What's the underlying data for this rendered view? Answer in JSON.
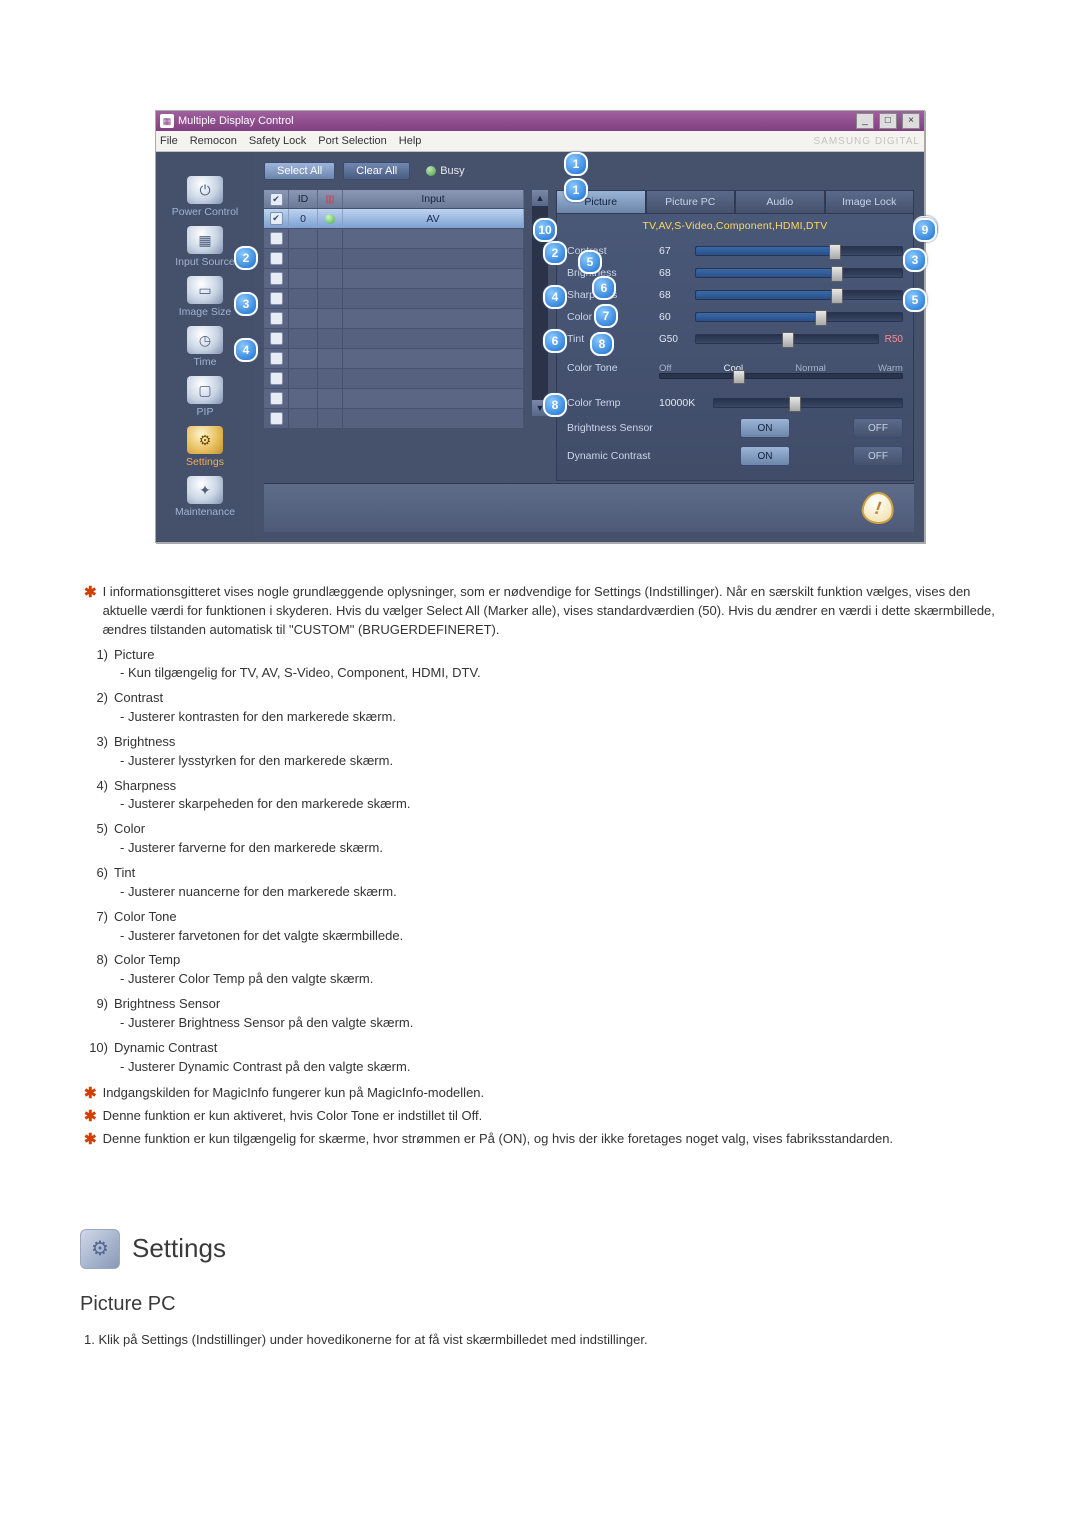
{
  "window": {
    "title": "Multiple Display Control",
    "menu": [
      "File",
      "Remocon",
      "Safety Lock",
      "Port Selection",
      "Help"
    ],
    "brand": "SAMSUNG DIGITAL"
  },
  "sidebar": {
    "items": [
      {
        "label": "Power Control",
        "glyph": "⏻"
      },
      {
        "label": "Input Source",
        "glyph": "▦"
      },
      {
        "label": "Image Size",
        "glyph": "▭"
      },
      {
        "label": "Time",
        "glyph": "◷"
      },
      {
        "label": "PIP",
        "glyph": "▢"
      },
      {
        "label": "Settings",
        "glyph": "⚙",
        "selected": true
      },
      {
        "label": "Maintenance",
        "glyph": "✦"
      }
    ]
  },
  "toolbar": {
    "select_all": "Select All",
    "clear_all": "Clear All",
    "busy": "Busy"
  },
  "grid": {
    "cols": [
      "",
      "ID",
      "",
      "Input"
    ],
    "rows": [
      {
        "checked": true,
        "id": "0",
        "status": "green",
        "input": "AV",
        "selected": true
      },
      {
        "checked": false
      },
      {
        "checked": false
      },
      {
        "checked": false
      },
      {
        "checked": false
      },
      {
        "checked": false
      },
      {
        "checked": false
      },
      {
        "checked": false
      },
      {
        "checked": false
      },
      {
        "checked": false
      },
      {
        "checked": false
      }
    ]
  },
  "tabs": [
    "Picture",
    "Picture PC",
    "Audio",
    "Image Lock"
  ],
  "panel": {
    "title": "TV,AV,S-Video,Component,HDMI,DTV",
    "sliders": {
      "contrast": {
        "label": "Contrast",
        "value": "67"
      },
      "brightness": {
        "label": "Brightness",
        "value": "68"
      },
      "sharpness": {
        "label": "Sharpness",
        "value": "68"
      },
      "color": {
        "label": "Color",
        "value": "60"
      },
      "tint": {
        "label": "Tint",
        "g": "G50",
        "r": "R50"
      }
    },
    "color_tone": {
      "label": "Color Tone",
      "opts": [
        "Off",
        "Cool",
        "Normal",
        "Warm"
      ]
    },
    "color_temp": {
      "label": "Color Temp",
      "value": "10000K"
    },
    "brightness_sensor": {
      "label": "Brightness Sensor",
      "on": "ON",
      "off": "OFF"
    },
    "dynamic_contrast": {
      "label": "Dynamic Contrast",
      "on": "ON",
      "off": "OFF"
    }
  },
  "notes": {
    "star1": "I informationsgitteret vises nogle grundlæggende oplysninger, som er nødvendige for Settings (Indstillinger). Når en særskilt funktion vælges, vises den aktuelle værdi for funktionen i skyderen. Hvis du vælger Select All (Marker alle), vises standardværdien (50). Hvis du ændrer en værdi i dette skærmbillede, ændres tilstanden automatisk til \"CUSTOM\" (BRUGERDEFINERET).",
    "items": [
      {
        "n": "1)",
        "t": "Picture",
        "d": "- Kun tilgængelig for TV, AV, S-Video, Component, HDMI, DTV."
      },
      {
        "n": "2)",
        "t": "Contrast",
        "d": "- Justerer kontrasten for den markerede skærm."
      },
      {
        "n": "3)",
        "t": "Brightness",
        "d": "- Justerer lysstyrken for den markerede skærm."
      },
      {
        "n": "4)",
        "t": "Sharpness",
        "d": "- Justerer skarpeheden for den markerede skærm."
      },
      {
        "n": "5)",
        "t": "Color",
        "d": "- Justerer farverne for den markerede skærm."
      },
      {
        "n": "6)",
        "t": "Tint",
        "d": "- Justerer nuancerne for den markerede skærm."
      },
      {
        "n": "7)",
        "t": "Color Tone",
        "d": "- Justerer farvetonen for det valgte skærmbillede."
      },
      {
        "n": "8)",
        "t": "Color Temp",
        "d": "- Justerer Color Temp på den valgte skærm."
      },
      {
        "n": "9)",
        "t": "Brightness Sensor",
        "d": "- Justerer Brightness Sensor på den valgte skærm."
      },
      {
        "n": "10)",
        "t": "Dynamic Contrast",
        "d": "- Justerer Dynamic Contrast på den valgte skærm."
      }
    ],
    "star2": "Indgangskilden for MagicInfo fungerer kun på MagicInfo-modellen.",
    "star3": "Denne funktion er kun aktiveret, hvis Color Tone er indstillet til Off.",
    "star4": "Denne funktion er kun tilgængelig for skærme, hvor strømmen er På (ON), og hvis der ikke foretages noget valg, vises fabriksstandarden."
  },
  "section": {
    "settings": "Settings",
    "picture_pc": "Picture PC",
    "step1": "1. Klik på Settings (Indstillinger) under hovedikonerne for at få vist skærmbilledet med indstillinger."
  }
}
